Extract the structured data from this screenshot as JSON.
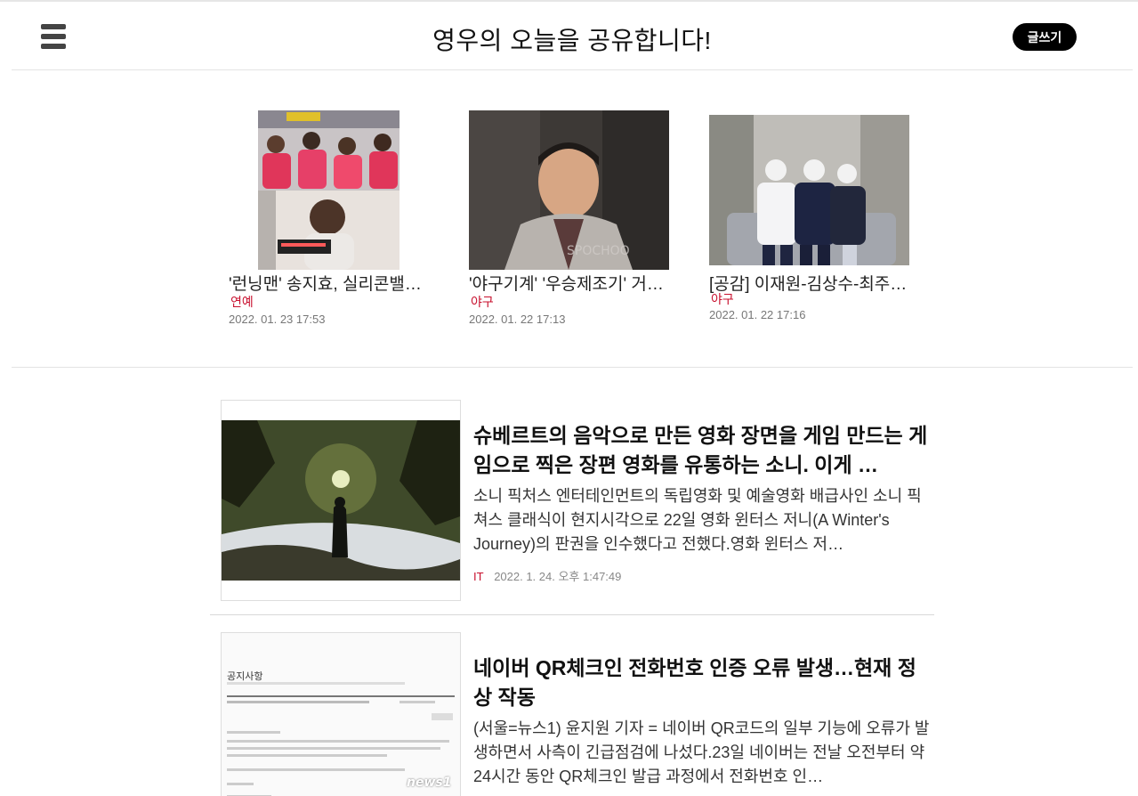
{
  "header": {
    "title": "영우의 오늘을 공유합니다!",
    "write_label": "글쓰기",
    "menu_icon": "hamburger-menu-icon"
  },
  "top_cards": [
    {
      "title": "'런닝맨' 송지효, 실리콘밸…",
      "category": "연예",
      "date": "2022. 01. 23 17:53"
    },
    {
      "title": "'야구기계' '우승제조기' 거…",
      "category": "야구",
      "date": "2022. 01. 22 17:13"
    },
    {
      "title": "[공감] 이재원-김상수-최주…",
      "category": "야구",
      "date": "2022. 01. 22 17:16"
    }
  ],
  "articles": [
    {
      "headline": "슈베르트의 음악으로 만든 영화 장면을 게임 만드는 게임으로 찍은 장편 영화를 유통하는 소니. 이게 …",
      "summary": "소니 픽처스 엔터테인먼트의 독립영화 및 예술영화 배급사인 소니 픽쳐스 클래식이 현지시각으로 22일 영화 윈터스 저니(A Winter's Journey)의 판권을 인수했다고 전했다.영화 윈터스 저…",
      "category": "IT",
      "date": "2022. 1. 24. 오후 1:47:49"
    },
    {
      "headline": "네이버 QR체크인 전화번호 인증 오류 발생…현재 정상 작동",
      "summary": "(서울=뉴스1) 윤지원 기자 = 네이버 QR코드의 일부 기능에 오류가 발생하면서 사측이 긴급점검에 나섰다.23일 네이버는 전날 오전부터 약 24시간 동안 QR체크인 발급 과정에서 전화번호 인…",
      "image_text": {
        "heading": "공지사항",
        "source": "news1"
      }
    }
  ],
  "colors": {
    "accent": "#c8102e",
    "button_bg": "#000000",
    "divider": "#e3e3e3"
  }
}
